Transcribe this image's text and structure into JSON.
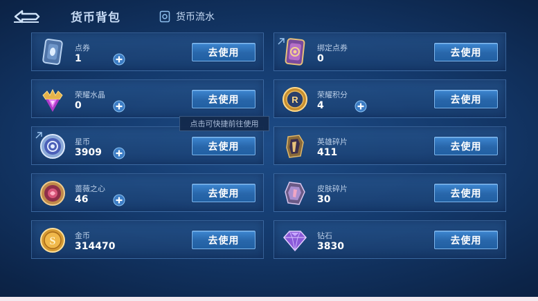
{
  "header": {
    "title": "货币背包",
    "ledger_label": "货币流水"
  },
  "tooltip": "点击可快捷前往使用",
  "use_label": "去使用",
  "currencies": [
    {
      "name": "点券",
      "value": "1",
      "has_plus": true,
      "icon": "coupon-icon"
    },
    {
      "name": "绑定点券",
      "value": "0",
      "has_plus": false,
      "icon": "bound-coupon-icon"
    },
    {
      "name": "荣耀水晶",
      "value": "0",
      "has_plus": true,
      "icon": "glory-crystal-icon"
    },
    {
      "name": "荣耀积分",
      "value": "4",
      "has_plus": true,
      "icon": "glory-points-icon"
    },
    {
      "name": "星币",
      "value": "3909",
      "has_plus": true,
      "icon": "star-coin-icon"
    },
    {
      "name": "英雄碎片",
      "value": "411",
      "has_plus": false,
      "icon": "hero-fragment-icon"
    },
    {
      "name": "蔷薇之心",
      "value": "46",
      "has_plus": true,
      "icon": "rose-heart-icon"
    },
    {
      "name": "皮肤碎片",
      "value": "30",
      "has_plus": false,
      "icon": "skin-fragment-icon"
    },
    {
      "name": "金币",
      "value": "314470",
      "has_plus": false,
      "icon": "gold-coin-icon"
    },
    {
      "name": "钻石",
      "value": "3830",
      "has_plus": false,
      "icon": "diamond-icon"
    }
  ],
  "colors": {
    "button": "#2866aa",
    "button_border": "#7fb9ef",
    "card_border": "#6ea0dc"
  }
}
